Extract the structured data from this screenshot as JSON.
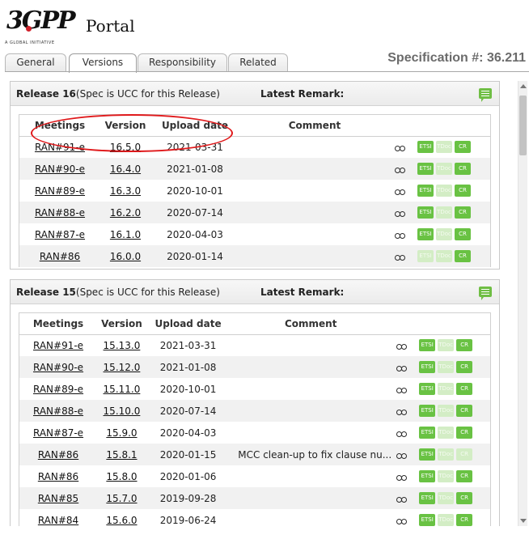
{
  "header": {
    "logo_text": "3GPP",
    "logo_tagline": "A GLOBAL INITIATIVE",
    "portal_text": "Portal",
    "spec_title": "Specification #: 36.211"
  },
  "tabs": [
    {
      "label": "General",
      "active": false
    },
    {
      "label": "Versions",
      "active": true
    },
    {
      "label": "Responsibility",
      "active": false
    },
    {
      "label": "Related",
      "active": false
    }
  ],
  "columns": {
    "meetings": "Meetings",
    "version": "Version",
    "upload_date": "Upload date",
    "comment": "Comment"
  },
  "badges": {
    "etsi": "ETSI",
    "tdoc": "TDoc",
    "cr": "CR"
  },
  "releases": [
    {
      "title": "Release 16",
      "subtitle": "(Spec is UCC for this Release)",
      "latest_remark": "Latest Remark:",
      "rows": [
        {
          "meeting": "RAN#91-e",
          "version": "16.5.0",
          "date": "2021-03-31",
          "comment": "",
          "tdoc_enabled": false,
          "cr_enabled": true
        },
        {
          "meeting": "RAN#90-e",
          "version": "16.4.0",
          "date": "2021-01-08",
          "comment": "",
          "tdoc_enabled": false,
          "cr_enabled": true
        },
        {
          "meeting": "RAN#89-e",
          "version": "16.3.0",
          "date": "2020-10-01",
          "comment": "",
          "tdoc_enabled": false,
          "cr_enabled": true
        },
        {
          "meeting": "RAN#88-e",
          "version": "16.2.0",
          "date": "2020-07-14",
          "comment": "",
          "tdoc_enabled": false,
          "cr_enabled": true
        },
        {
          "meeting": "RAN#87-e",
          "version": "16.1.0",
          "date": "2020-04-03",
          "comment": "",
          "tdoc_enabled": false,
          "cr_enabled": true
        },
        {
          "meeting": "RAN#86",
          "version": "16.0.0",
          "date": "2020-01-14",
          "comment": "",
          "etsi_enabled": false,
          "tdoc_enabled": false,
          "cr_enabled": true
        }
      ]
    },
    {
      "title": "Release 15",
      "subtitle": "(Spec is UCC for this Release)",
      "latest_remark": "Latest Remark:",
      "rows": [
        {
          "meeting": "RAN#91-e",
          "version": "15.13.0",
          "date": "2021-03-31",
          "comment": "",
          "tdoc_enabled": false,
          "cr_enabled": true
        },
        {
          "meeting": "RAN#90-e",
          "version": "15.12.0",
          "date": "2021-01-08",
          "comment": "",
          "tdoc_enabled": false,
          "cr_enabled": true
        },
        {
          "meeting": "RAN#89-e",
          "version": "15.11.0",
          "date": "2020-10-01",
          "comment": "",
          "tdoc_enabled": false,
          "cr_enabled": true
        },
        {
          "meeting": "RAN#88-e",
          "version": "15.10.0",
          "date": "2020-07-14",
          "comment": "",
          "tdoc_enabled": false,
          "cr_enabled": true
        },
        {
          "meeting": "RAN#87-e",
          "version": "15.9.0",
          "date": "2020-04-03",
          "comment": "",
          "tdoc_enabled": false,
          "cr_enabled": true
        },
        {
          "meeting": "RAN#86",
          "version": "15.8.1",
          "date": "2020-01-15",
          "comment": "MCC clean-up to fix clause nu...",
          "tdoc_enabled": false,
          "cr_enabled": false
        },
        {
          "meeting": "RAN#86",
          "version": "15.8.0",
          "date": "2020-01-06",
          "comment": "",
          "tdoc_enabled": false,
          "cr_enabled": true
        },
        {
          "meeting": "RAN#85",
          "version": "15.7.0",
          "date": "2019-09-28",
          "comment": "",
          "tdoc_enabled": false,
          "cr_enabled": true
        },
        {
          "meeting": "RAN#84",
          "version": "15.6.0",
          "date": "2019-06-24",
          "comment": "",
          "tdoc_enabled": false,
          "cr_enabled": true
        }
      ]
    }
  ],
  "colors": {
    "accent_green": "#69c243",
    "annotation_red": "#e0191b",
    "spec_title_gray": "#6b6b6b"
  },
  "icons": {
    "view": "glasses-icon",
    "remark": "comment-icon",
    "scroll_up": "arrow-up-icon",
    "scroll_down": "arrow-down-icon"
  }
}
